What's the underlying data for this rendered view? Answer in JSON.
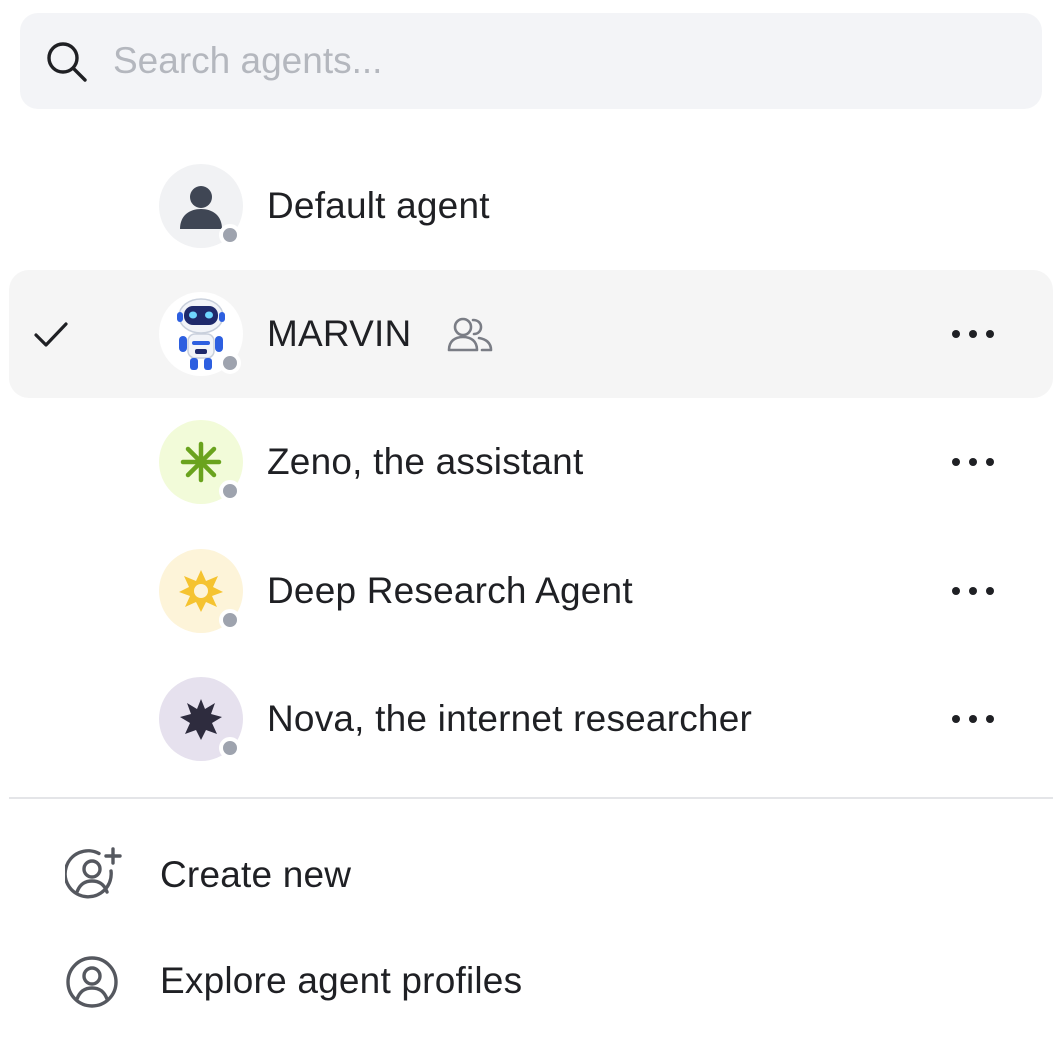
{
  "search": {
    "placeholder": "Search agents...",
    "value": "",
    "icon": "search-icon"
  },
  "agents": [
    {
      "name": "Default agent",
      "avatar": "person-silhouette",
      "avatar_bg": "#f1f2f4",
      "selected": false,
      "shared": false,
      "has_menu": false
    },
    {
      "name": "MARVIN",
      "avatar": "robot",
      "avatar_bg": "#ffffff",
      "selected": true,
      "shared": true,
      "has_menu": true
    },
    {
      "name": "Zeno, the assistant",
      "avatar": "green-asterisk",
      "avatar_bg": "#f2fbd9",
      "selected": false,
      "shared": false,
      "has_menu": true
    },
    {
      "name": "Deep Research Agent",
      "avatar": "yellow-sun",
      "avatar_bg": "#fdf4d9",
      "selected": false,
      "shared": false,
      "has_menu": true
    },
    {
      "name": "Nova, the internet researcher",
      "avatar": "dark-starburst",
      "avatar_bg": "#e6e1ee",
      "selected": false,
      "shared": false,
      "has_menu": true
    }
  ],
  "actions": {
    "create_new": "Create new",
    "explore_profiles": "Explore agent profiles"
  },
  "colors": {
    "selected_row_bg": "#f5f5f5",
    "search_bg": "#f3f4f7",
    "status_dot": "#9ea3ae",
    "text": "#1f2024"
  }
}
